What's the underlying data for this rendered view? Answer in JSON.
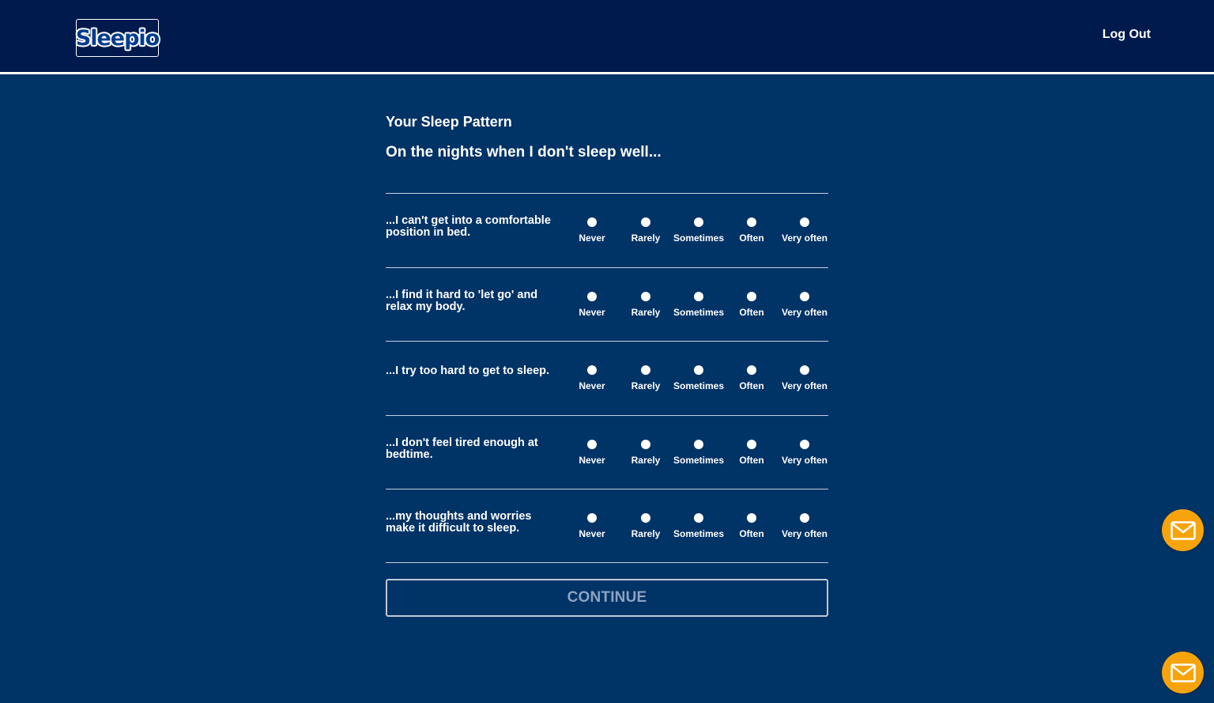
{
  "header": {
    "logo_text": "Sleepio",
    "logout_label": "Log Out"
  },
  "page": {
    "section_title": "Your Sleep Pattern",
    "intro": "On the nights when I don't sleep well..."
  },
  "options": [
    "Never",
    "Rarely",
    "Sometimes",
    "Often",
    "Very often"
  ],
  "questions": [
    {
      "text": "...I can't get into a comfortable position in bed."
    },
    {
      "text": "...I find it hard to 'let go' and relax my body."
    },
    {
      "text": "...I try too hard to get to sleep."
    },
    {
      "text": "...I don't feel tired enough at bedtime."
    },
    {
      "text": "...my thoughts and worries make it difficult to sleep."
    }
  ],
  "footer": {
    "continue_label": "CONTINUE"
  },
  "icons": {
    "message": "envelope-icon"
  },
  "colors": {
    "background": "#003366",
    "header": "#001a4d",
    "accent": "#f7a40c"
  }
}
